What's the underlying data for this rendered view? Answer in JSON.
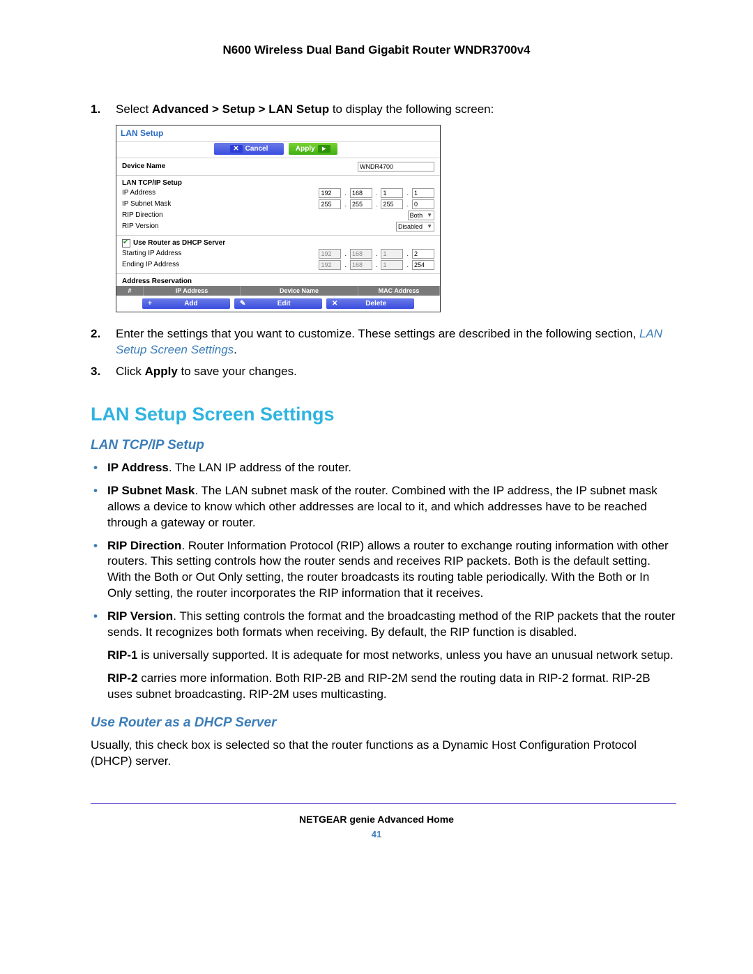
{
  "header": {
    "title": "N600 Wireless Dual Band Gigabit Router WNDR3700v4"
  },
  "steps": [
    {
      "num": "1.",
      "pre": "Select ",
      "bold": "Advanced > Setup > LAN Setup",
      "post": " to display the following screen:"
    },
    {
      "num": "2.",
      "pre": "Enter the settings that you want to customize. These settings are described in the following section, ",
      "link": "LAN Setup Screen Settings",
      "post": "."
    },
    {
      "num": "3.",
      "pre": "Click ",
      "bold": "Apply",
      "post": " to save your changes."
    }
  ],
  "screenshot": {
    "title": "LAN Setup",
    "cancel": "Cancel",
    "apply": "Apply",
    "device_name_label": "Device Name",
    "device_name_value": "WNDR4700",
    "lan_section": "LAN TCP/IP Setup",
    "ip_label": "IP Address",
    "ip": [
      "192",
      "168",
      "1",
      "1"
    ],
    "mask_label": "IP Subnet Mask",
    "mask": [
      "255",
      "255",
      "255",
      "0"
    ],
    "rip_dir_label": "RIP Direction",
    "rip_dir_value": "Both",
    "rip_ver_label": "RIP Version",
    "rip_ver_value": "Disabled",
    "dhcp_label": "Use Router as DHCP Server",
    "start_ip_label": "Starting IP Address",
    "start_ip": [
      "192",
      "168",
      "1",
      "2"
    ],
    "end_ip_label": "Ending IP Address",
    "end_ip": [
      "192",
      "168",
      "1",
      "254"
    ],
    "addr_res": "Address Reservation",
    "th": [
      "#",
      "IP Address",
      "Device Name",
      "MAC Address"
    ],
    "add": "Add",
    "edit": "Edit",
    "delete": "Delete"
  },
  "heading": "LAN Setup Screen Settings",
  "sub1": "LAN TCP/IP Setup",
  "bullets": [
    {
      "bold": "IP Address",
      "text": ". The LAN IP address of the router."
    },
    {
      "bold": "IP Subnet Mask",
      "text": ". The LAN subnet mask of the router. Combined with the IP address, the IP subnet mask allows a device to know which other addresses are local to it, and which addresses have to be reached through a gateway or router."
    },
    {
      "bold": "RIP Direction",
      "text": ". Router Information Protocol (RIP) allows a router to exchange routing information with other routers. This setting controls how the router sends and receives RIP packets. Both is the default setting. With the Both or Out Only setting, the router broadcasts its routing table periodically. With the Both or In Only setting, the router incorporates the RIP information that it receives."
    },
    {
      "bold": "RIP Version",
      "text": ". This setting controls the format and the broadcasting method of the RIP packets that the router sends. It recognizes both formats when receiving. By default, the RIP function is disabled."
    }
  ],
  "rip1": {
    "bold": "RIP-1",
    "text": " is universally supported. It is adequate for most networks, unless you have an unusual network setup."
  },
  "rip2": {
    "bold": "RIP-2",
    "text": " carries more information. Both RIP-2B and RIP-2M send the routing data in RIP-2 format. RIP-2B uses subnet broadcasting. RIP-2M uses multicasting."
  },
  "sub2": "Use Router as a DHCP Server",
  "dhcp_text": "Usually, this check box is selected so that the router functions as a Dynamic Host Configuration Protocol (DHCP) server.",
  "footer": {
    "title": "NETGEAR genie Advanced Home",
    "page": "41"
  }
}
